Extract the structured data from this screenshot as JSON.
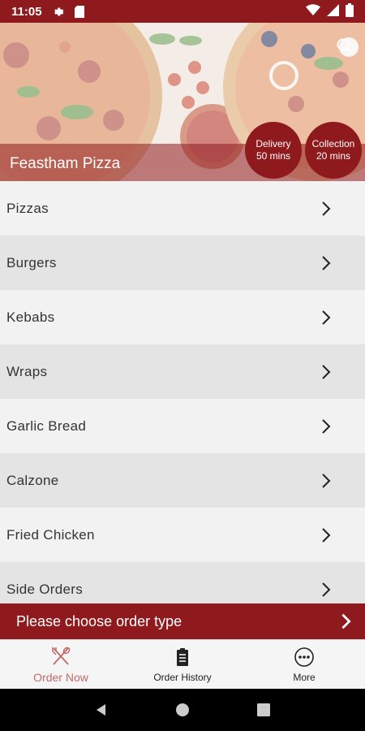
{
  "status_bar": {
    "time": "11:05",
    "icons_left": [
      "gear-icon",
      "sim-card-icon"
    ],
    "icons_right": [
      "wifi-icon",
      "signal-icon",
      "battery-icon"
    ]
  },
  "hero": {
    "title": "Feastham Pizza",
    "delivery": {
      "label": "Delivery",
      "time": "50 mins"
    },
    "collection": {
      "label": "Collection",
      "time": "20 mins"
    }
  },
  "menu": {
    "items": [
      {
        "label": "Pizzas"
      },
      {
        "label": "Burgers"
      },
      {
        "label": "Kebabs"
      },
      {
        "label": "Wraps"
      },
      {
        "label": "Garlic Bread"
      },
      {
        "label": "Calzone"
      },
      {
        "label": "Fried Chicken"
      },
      {
        "label": "Side Orders"
      }
    ]
  },
  "order_bar": {
    "label": "Please choose order type"
  },
  "tabs": [
    {
      "label": "Order Now",
      "icon": "fork-knife-icon",
      "active": true
    },
    {
      "label": "Order History",
      "icon": "clipboard-icon",
      "active": false
    },
    {
      "label": "More",
      "icon": "more-icon",
      "active": false
    }
  ],
  "colors": {
    "brand": "#8f1a1d",
    "active_tab": "#c26a6b"
  }
}
